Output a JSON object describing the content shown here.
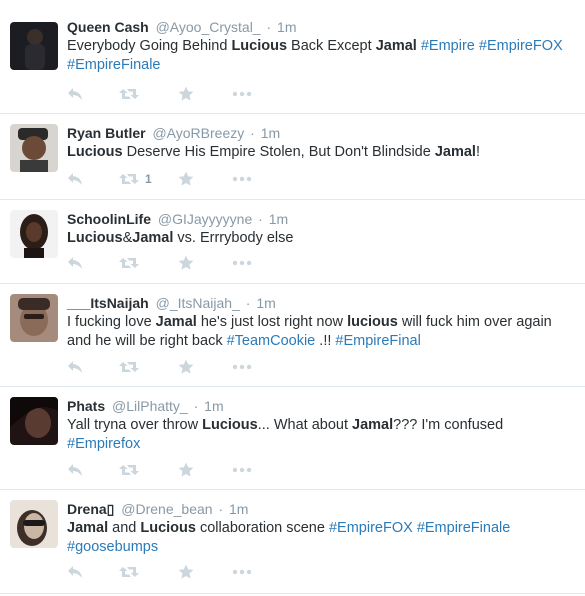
{
  "tweets": [
    {
      "name": "Queen Cash",
      "handle": "@Ayoo_Crystal_",
      "time": "1m",
      "segments": [
        {
          "t": "Everybody Going Behind "
        },
        {
          "t": "Lucious",
          "b": true
        },
        {
          "t": " Back Except "
        },
        {
          "t": "Jamal",
          "b": true
        },
        {
          "t": " "
        },
        {
          "t": "#Empire",
          "h": true
        },
        {
          "t": " "
        },
        {
          "t": "#EmpireFOX",
          "h": true
        },
        {
          "t": " "
        },
        {
          "t": "#EmpireFinale",
          "h": true
        }
      ],
      "retweets": "",
      "avatar_colors": [
        "#1b1d22",
        "#3a2f2b"
      ]
    },
    {
      "name": "Ryan Butler",
      "handle": "@AyoRBreezy",
      "time": "1m",
      "segments": [
        {
          "t": "Lucious",
          "b": true
        },
        {
          "t": " Deserve His Empire Stolen, But Don't Blindside "
        },
        {
          "t": "Jamal",
          "b": true
        },
        {
          "t": "!"
        }
      ],
      "retweets": "1",
      "avatar_colors": [
        "#6b4a37",
        "#2a2a2a"
      ]
    },
    {
      "name": "SchoolinLife",
      "handle": "@GIJayyyyyne",
      "time": "1m",
      "segments": [
        {
          "t": "Lucious",
          "b": true
        },
        {
          "t": "&"
        },
        {
          "t": "Jamal",
          "b": true
        },
        {
          "t": " vs. Errrybody else"
        }
      ],
      "retweets": "",
      "avatar_colors": [
        "#f2f2f2",
        "#2b1d17"
      ]
    },
    {
      "name": "___ItsNaijah",
      "handle": "@_ItsNaijah_",
      "time": "1m",
      "segments": [
        {
          "t": "I fucking love "
        },
        {
          "t": "Jamal",
          "b": true
        },
        {
          "t": " he's just lost right now "
        },
        {
          "t": "lucious",
          "b": true
        },
        {
          "t": " will fuck him over again and he will be right back "
        },
        {
          "t": "#TeamCookie",
          "h": true
        },
        {
          "t": " .!! "
        },
        {
          "t": "#EmpireFinal",
          "h": true
        }
      ],
      "retweets": "",
      "avatar_colors": [
        "#8a6a58",
        "#3b2b26"
      ]
    },
    {
      "name": "Phats",
      "handle": "@LilPhatty_",
      "time": "1m",
      "segments": [
        {
          "t": "Yall tryna over throw "
        },
        {
          "t": "Lucious",
          "b": true
        },
        {
          "t": "... What about "
        },
        {
          "t": "Jamal",
          "b": true
        },
        {
          "t": "???  I'm confused "
        },
        {
          "t": "#Empirefox",
          "h": true
        }
      ],
      "retweets": "",
      "avatar_colors": [
        "#5a3b32",
        "#1f1413"
      ]
    },
    {
      "name": "Drena▯",
      "handle": "@Drene_bean",
      "time": "1m",
      "segments": [
        {
          "t": "Jamal",
          "b": true
        },
        {
          "t": " and "
        },
        {
          "t": "Lucious",
          "b": true
        },
        {
          "t": " collaboration scene "
        },
        {
          "t": "#EmpireFOX",
          "h": true
        },
        {
          "t": " "
        },
        {
          "t": "#EmpireFinale",
          "h": true
        },
        {
          "t": " "
        },
        {
          "t": "#goosebumps",
          "h": true
        }
      ],
      "retweets": "",
      "avatar_colors": [
        "#c9b7a4",
        "#3d2e27"
      ]
    }
  ],
  "icons": {
    "reply": "reply-icon",
    "retweet": "retweet-icon",
    "favorite": "star-icon",
    "more": "more-icon"
  },
  "colors": {
    "action_icon": "#ccd6dd",
    "hashtag": "#2b7bb9",
    "meta_text": "#8899a6",
    "divider": "#e1e8ed"
  }
}
